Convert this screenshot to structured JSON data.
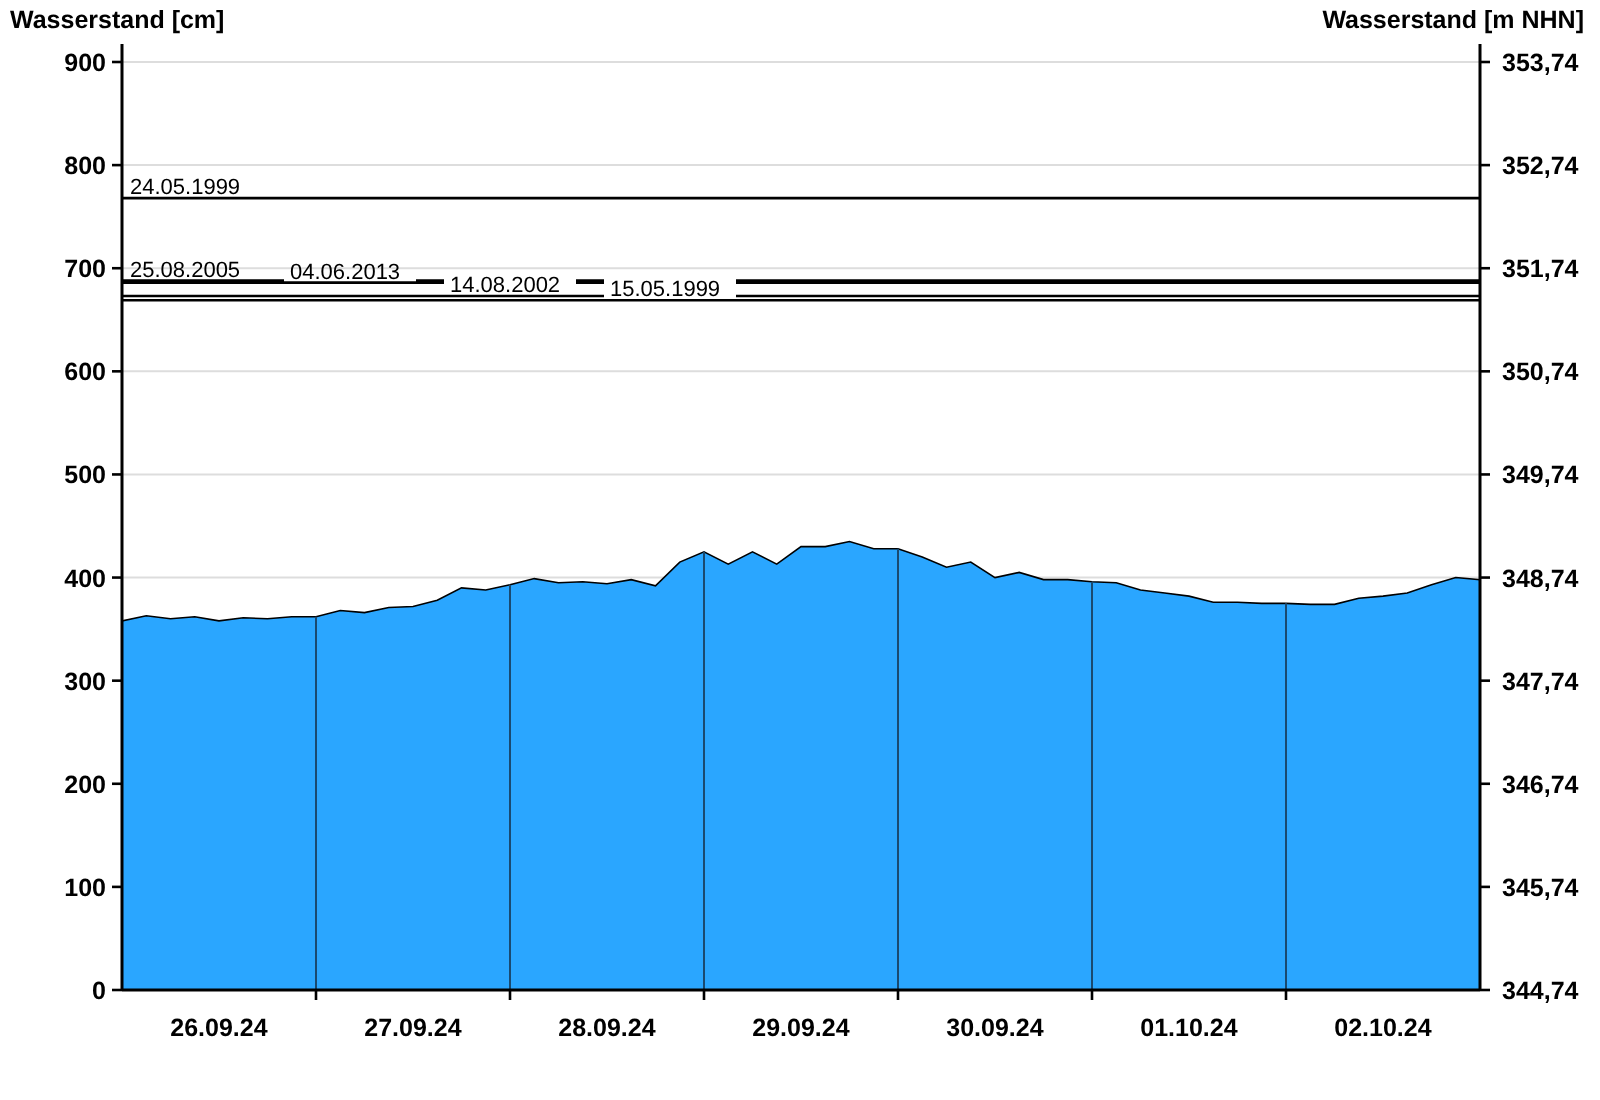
{
  "chart_data": {
    "type": "area",
    "ylabel": "Wasserstand [cm]",
    "y2label": "Wasserstand [m NHN]",
    "ylim": [
      0,
      900
    ],
    "y2lim": [
      344.74,
      353.74
    ],
    "categories": [
      null,
      null,
      null,
      null,
      "26.09.24",
      null,
      null,
      null,
      null,
      null,
      null,
      null,
      "27.09.24",
      null,
      null,
      null,
      null,
      null,
      null,
      null,
      "28.09.24",
      null,
      null,
      null,
      null,
      null,
      null,
      null,
      "29.09.24",
      null,
      null,
      null,
      null,
      null,
      null,
      null,
      "30.09.24",
      null,
      null,
      null,
      null,
      null,
      null,
      null,
      "01.10.24",
      null,
      null,
      null,
      null,
      null,
      null,
      null,
      "02.10.24",
      null,
      null,
      null,
      null
    ],
    "grid": true,
    "series": [
      {
        "color": "#2aa6ff",
        "values": [
          358,
          363,
          360,
          362,
          358,
          361,
          360,
          362,
          362,
          368,
          366,
          371,
          372,
          378,
          390,
          388,
          393,
          399,
          395,
          396,
          394,
          398,
          392,
          415,
          425,
          413,
          425,
          413,
          430,
          430,
          435,
          428,
          428,
          420,
          410,
          415,
          400,
          405,
          398,
          398,
          396,
          395,
          388,
          385,
          382,
          376,
          376,
          375,
          375,
          374,
          374,
          380,
          382,
          385,
          393,
          400,
          398
        ]
      }
    ],
    "yticks": [
      0,
      100,
      200,
      300,
      400,
      500,
      600,
      700,
      800,
      900
    ],
    "y2ticks": [
      {
        "value": 344.74,
        "label": "344,74"
      },
      {
        "value": 345.74,
        "label": "345,74"
      },
      {
        "value": 346.74,
        "label": "346,74"
      },
      {
        "value": 347.74,
        "label": "347,74"
      },
      {
        "value": 348.74,
        "label": "348,74"
      },
      {
        "value": 349.74,
        "label": "349,74"
      },
      {
        "value": 350.74,
        "label": "350,74"
      },
      {
        "value": 351.74,
        "label": "351,74"
      },
      {
        "value": 352.74,
        "label": "352,74"
      },
      {
        "value": 353.74,
        "label": "353,74"
      }
    ],
    "ref_lines": [
      {
        "axis": "y",
        "value": 768,
        "label": "24.05.1999"
      },
      {
        "axis": "y",
        "value": 688,
        "label": "25.08.2005"
      },
      {
        "axis": "y",
        "value": 686,
        "label": "04.06.2013"
      },
      {
        "axis": "y",
        "value": 673,
        "label": "14.08.2002"
      },
      {
        "axis": "y",
        "value": 669,
        "label": "15.05.1999"
      }
    ]
  }
}
